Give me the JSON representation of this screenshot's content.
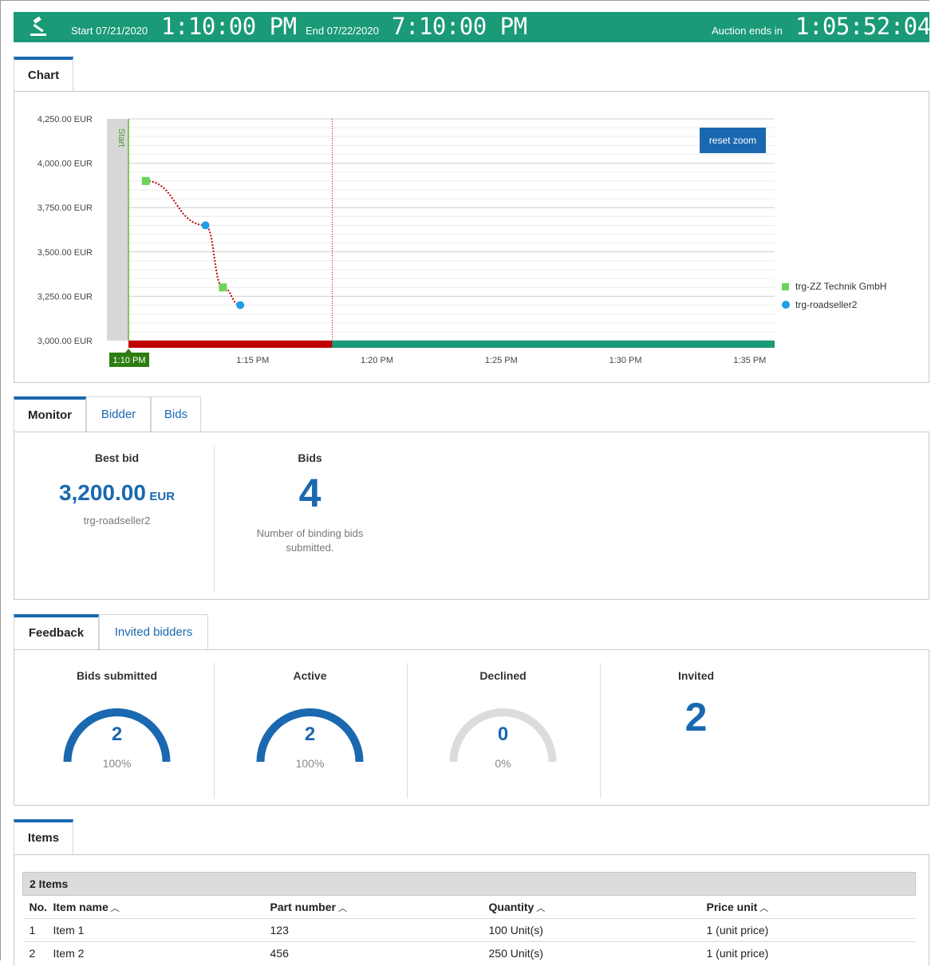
{
  "header": {
    "start_label": "Start 07/21/2020",
    "start_time": "1:10:00 PM",
    "end_label": "End 07/22/2020",
    "end_time": "7:10:00 PM",
    "countdown_label": "Auction ends in",
    "countdown": "1:05:52:04",
    "bg_color": "#1a9a77",
    "icon": "gavel-icon"
  },
  "chart_section": {
    "tab": "Chart",
    "reset_zoom": "reset zoom",
    "start_marker": "Start"
  },
  "chart_data": {
    "type": "line",
    "y_tick_labels": [
      "4,250.00 EUR",
      "4,000.00 EUR",
      "3,750.00 EUR",
      "3,500.00 EUR",
      "3,250.00 EUR",
      "3,000.00 EUR"
    ],
    "y_ticks": [
      4250,
      4000,
      3750,
      3500,
      3250,
      3000
    ],
    "ylim": [
      3000,
      4250
    ],
    "x_tick_labels": [
      "1:10 PM",
      "1:15 PM",
      "1:20 PM",
      "1:25 PM",
      "1:30 PM",
      "1:35 PM"
    ],
    "x_ticks_minutes": [
      10,
      15,
      20,
      25,
      30,
      35
    ],
    "xlim_minutes_after_1pm": [
      10,
      36
    ],
    "current_time_minutes": 18.2,
    "series": [
      {
        "name": "trg-ZZ Technik GmbH",
        "marker": "square",
        "color": "#6cd35a",
        "points": [
          [
            10.7,
            3900
          ],
          [
            13.8,
            3300
          ]
        ]
      },
      {
        "name": "trg-roadseller2",
        "marker": "circle",
        "color": "#1e9ee6",
        "points": [
          [
            13.1,
            3650
          ],
          [
            14.5,
            3200
          ]
        ]
      }
    ],
    "trend_line_color": "#c00000",
    "elapsed_bar_color": "#c00000",
    "remaining_bar_color": "#1a9a77",
    "grid": true,
    "legend_position": "right"
  },
  "monitor": {
    "tabs": [
      "Monitor",
      "Bidder",
      "Bids"
    ],
    "best_bid_title": "Best bid",
    "best_bid_value": "3,200.00",
    "best_bid_currency": "EUR",
    "best_bid_bidder": "trg-roadseller2",
    "bids_title": "Bids",
    "bids_count": "4",
    "bids_caption_1": "Number of binding bids",
    "bids_caption_2": "submitted."
  },
  "feedback": {
    "tabs": [
      "Feedback",
      "Invited bidders"
    ],
    "stats": [
      {
        "title": "Bids submitted",
        "value": "2",
        "pct": "100%",
        "fraction": 1.0
      },
      {
        "title": "Active",
        "value": "2",
        "pct": "100%",
        "fraction": 1.0
      },
      {
        "title": "Declined",
        "value": "0",
        "pct": "0%",
        "fraction": 0.0
      }
    ],
    "invited_title": "Invited",
    "invited_value": "2",
    "accent": "#1a68b0"
  },
  "items": {
    "tab": "Items",
    "group_label": "2 Items",
    "columns": [
      "No.",
      "Item name",
      "Part number",
      "Quantity",
      "Price unit"
    ],
    "rows": [
      [
        "1",
        "Item 1",
        "123",
        "100 Unit(s)",
        "1 (unit price)"
      ],
      [
        "2",
        "Item 2",
        "456",
        "250 Unit(s)",
        "1 (unit price)"
      ]
    ]
  }
}
